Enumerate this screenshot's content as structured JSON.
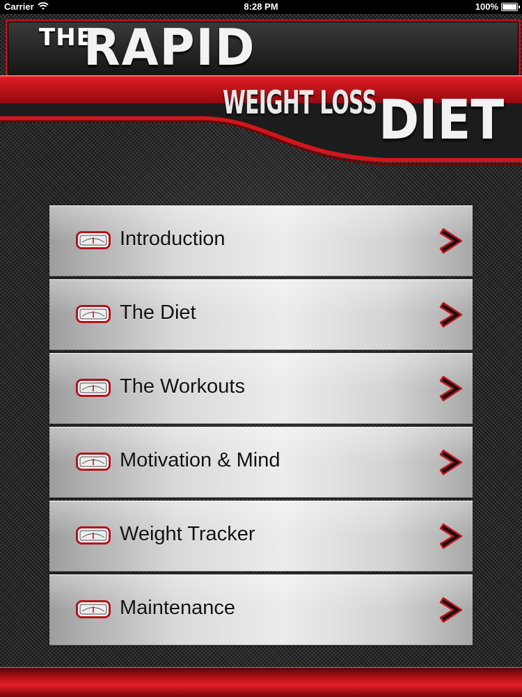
{
  "status_bar": {
    "carrier": "Carrier",
    "time": "8:28 PM",
    "battery": "100%"
  },
  "header": {
    "title_the": "THE",
    "title_rapid": "RAPID",
    "title_weight_loss": "WEIGHT LOSS",
    "title_diet": "DIET"
  },
  "menu": {
    "items": [
      {
        "label": "Introduction",
        "icon": "scale-icon",
        "arrow": "chevron-right-icon"
      },
      {
        "label": "The Diet",
        "icon": "scale-icon",
        "arrow": "chevron-right-icon"
      },
      {
        "label": "The Workouts",
        "icon": "scale-icon",
        "arrow": "chevron-right-icon"
      },
      {
        "label": "Motivation & Mind",
        "icon": "scale-icon",
        "arrow": "chevron-right-icon"
      },
      {
        "label": "Weight Tracker",
        "icon": "scale-icon",
        "arrow": "chevron-right-icon"
      },
      {
        "label": "Maintenance",
        "icon": "scale-icon",
        "arrow": "chevron-right-icon"
      }
    ]
  },
  "colors": {
    "accent_red": "#c4141b",
    "dark_bg": "#2d2d2d",
    "button_silver": "#d9d9d9"
  }
}
